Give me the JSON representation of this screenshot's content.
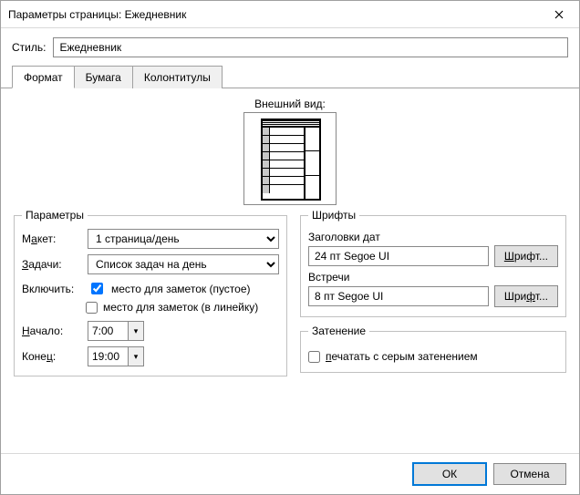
{
  "title": "Параметры страницы: Ежедневник",
  "style_label": "Стиль:",
  "style_value": "Ежедневник",
  "tabs": {
    "format": "Формат",
    "paper": "Бумага",
    "headers": "Колонтитулы"
  },
  "preview_label": "Внешний вид:",
  "params": {
    "legend": "Параметры",
    "layout_label_pre": "М",
    "layout_label_hot": "а",
    "layout_label_post": "кет:",
    "layout_value": "1 страница/день",
    "tasks_label_hot": "З",
    "tasks_label_post": "адачи:",
    "tasks_value": "Список задач на день",
    "include_label": "Включить:",
    "notes_blank": "место для заметок (пустое)",
    "notes_lined": "место для заметок (в линейку)",
    "start_label_hot": "Н",
    "start_label_post": "ачало:",
    "start_value": "7:00",
    "end_label_pre": "Коне",
    "end_label_hot": "ц",
    "end_label_post": ":",
    "end_value": "19:00"
  },
  "fonts": {
    "legend": "Шрифты",
    "date_headers_label": "Заголовки дат",
    "date_headers_value": "24 пт Segoe UI",
    "appt_label": "Встречи",
    "appt_value": "8 пт Segoe UI",
    "font_button": "Шрифт..."
  },
  "shading": {
    "legend": "Затенение",
    "checkbox_label": "печатать с серым затенением"
  },
  "buttons": {
    "ok": "ОК",
    "cancel": "Отмена"
  }
}
